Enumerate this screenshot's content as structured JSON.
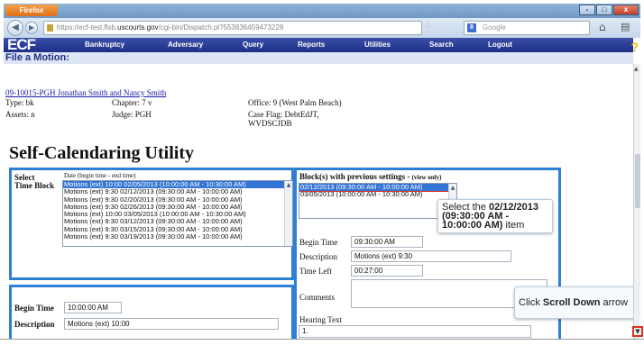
{
  "browser": {
    "app_button": "Firefox",
    "url_prefix": "https://ecf-test.flsb.",
    "url_domain": "uscourts.gov",
    "url_path": "/cgi-bin/Dispatch.pl?553836459473228",
    "search_placeholder": "Google",
    "window_controls": [
      "-",
      "□",
      "x"
    ]
  },
  "ecf": {
    "logo": "ECF",
    "menu": [
      "Bankruptcy",
      "Adversary",
      "Query",
      "Reports",
      "Utilities",
      "Search",
      "Logout"
    ],
    "help": "?",
    "page_title": "File a Motion:"
  },
  "case": {
    "link": "09-10015-PGH Jonathan Smith and Nancy Smith",
    "type": "Type: bk",
    "chapter": "Chapter: 7 v",
    "office": "Office: 9 (West Palm Beach)",
    "assets": "Assets: n",
    "judge": "Judge: PGH",
    "case_flag": "Case Flag: DebtEdJT,",
    "case_flag_2": "WVDSCJDB"
  },
  "heading": "Self-Calendaring Utility",
  "left_panel": {
    "select_label": "Select",
    "time_block_label": "Time Block",
    "date_header": "Date (begin time - end time)",
    "time_blocks": [
      "Motions (ext) 10:00 02/05/2013 (10:00:00 AM - 10:30:00 AM)",
      "Motions (ext) 9:30 02/12/2013 (09:30:00 AM - 10:00:00 AM)",
      "Motions (ext) 9:30 02/20/2013 (09:30:00 AM - 10:00:00 AM)",
      "Motions (ext) 9:30 02/26/2013 (09:30:00 AM - 10:00:00 AM)",
      "Motions (ext) 10:00 03/05/2013 (10:00:00 AM - 10:30:00 AM)",
      "Motions (ext) 9:30 03/12/2013 (09:30:00 AM - 10:00:00 AM)",
      "Motions (ext) 9:30 03/15/2013 (09:30:00 AM - 10:00:00 AM)",
      "Motions (ext) 9:30 03/19/2013 (09:30:00 AM - 10:00:00 AM)"
    ],
    "begin_time_label": "Begin Time",
    "begin_time_value": "10:00:00 AM",
    "description_label": "Description",
    "description_value": "Motions (ext) 10:00"
  },
  "right_panel": {
    "header": "Block(s) with previous settings -",
    "header_note": "(view only)",
    "blocks": [
      "02/12/2013 (09:30:00 AM - 10:00:00 AM)",
      "03/05/2013 (10:00:00 AM - 10:30:00 AM)"
    ],
    "begin_time_label": "Begin Time",
    "begin_time_value": "09:30:00 AM",
    "description_label": "Description",
    "description_value": "Motions (ext) 9:30",
    "time_left_label": "Time Left",
    "time_left_value": "00:27:00",
    "comments_label": "Comments",
    "hearing_text_label": "Hearing Text",
    "hearing_text_value": "1."
  },
  "callouts": {
    "select_prefix": "Select the ",
    "select_bold": "02/12/2013 (09:30:00 AM - 10:00:00 AM)",
    "select_suffix": " item",
    "scroll_prefix": "Click ",
    "scroll_bold": "Scroll Down",
    "scroll_suffix": " arrow"
  }
}
